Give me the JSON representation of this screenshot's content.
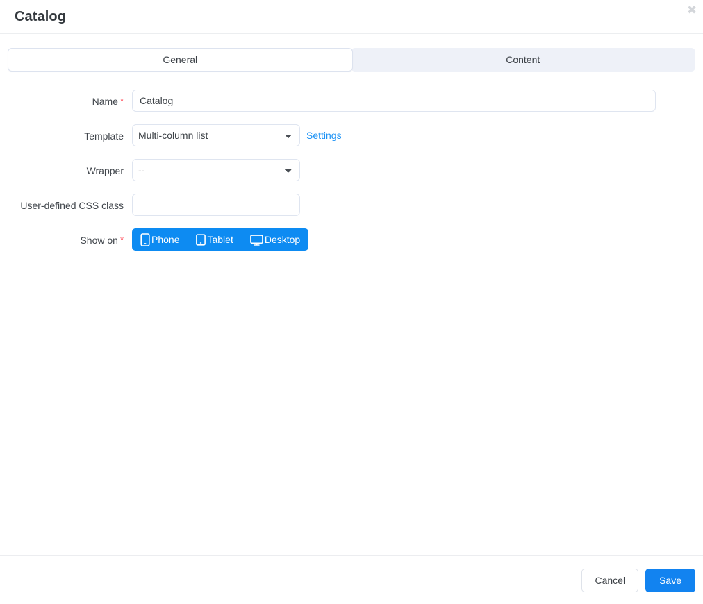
{
  "header": {
    "title": "Catalog",
    "close_label": "✖"
  },
  "tabs": [
    {
      "id": "general",
      "label": "General",
      "active": true
    },
    {
      "id": "content",
      "label": "Content",
      "active": false
    }
  ],
  "form": {
    "name": {
      "label": "Name",
      "required_marker": "*",
      "value": "Catalog",
      "placeholder": ""
    },
    "template": {
      "label": "Template",
      "selected": "Multi-column list",
      "settings_link": "Settings"
    },
    "wrapper": {
      "label": "Wrapper",
      "selected": "--"
    },
    "css_class": {
      "label": "User-defined CSS class",
      "value": "",
      "placeholder": ""
    },
    "show_on": {
      "label": "Show on",
      "required_marker": "*",
      "options": [
        {
          "id": "phone",
          "label": "Phone",
          "icon": "phone-icon",
          "active": true
        },
        {
          "id": "tablet",
          "label": "Tablet",
          "icon": "tablet-icon",
          "active": true
        },
        {
          "id": "desktop",
          "label": "Desktop",
          "icon": "desktop-icon",
          "active": true
        }
      ]
    }
  },
  "footer": {
    "cancel_label": "Cancel",
    "save_label": "Save"
  },
  "colors": {
    "accent": "#1283f0",
    "device_active": "#0d8bf2",
    "link": "#1e93f5",
    "required": "#ff4d5a",
    "tab_inactive_bg": "#eef1f8"
  }
}
